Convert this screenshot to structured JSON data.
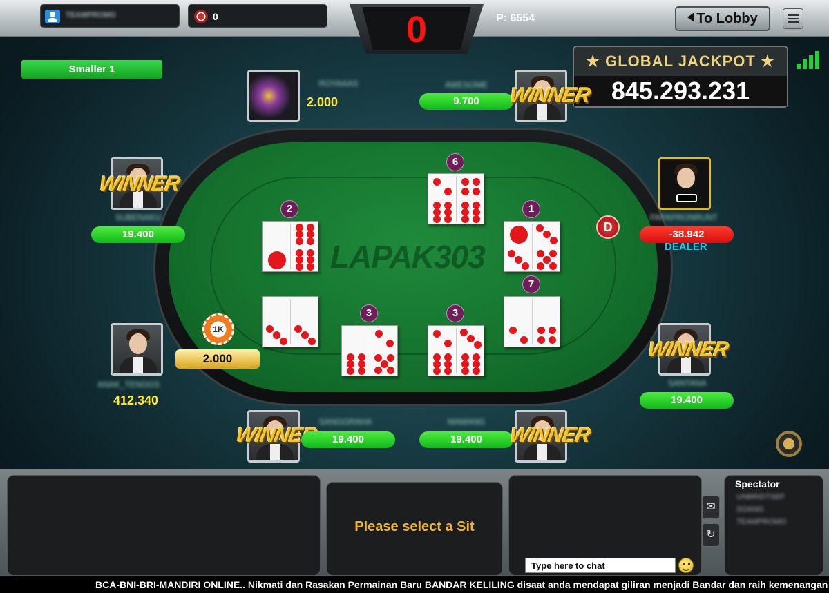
{
  "topbar": {
    "username": "TEAMPROMO",
    "chips": "0",
    "score": "0",
    "points": "P: 6554",
    "lobby_label": "To Lobby"
  },
  "jackpot": {
    "title": "★ GLOBAL JACKPOT ★",
    "value": "845.293.231"
  },
  "rule_banner": "Smaller 1",
  "players": [
    {
      "seat": "top-left",
      "name": "ROYAAAS",
      "amount": "2.000",
      "winner": false
    },
    {
      "seat": "top-right",
      "name": "AWESOME",
      "amount": "9.700",
      "winner": true
    },
    {
      "seat": "left",
      "name": "SUBENAKU",
      "amount": "19.400",
      "winner": true
    },
    {
      "seat": "right-dealer",
      "name": "PAPAPRONRUNT",
      "amount": "-38.942",
      "winner": false,
      "role": "DEALER"
    },
    {
      "seat": "bottom-left-self",
      "name": "ANAK_TENGGS",
      "amount": "412.340",
      "winner": false
    },
    {
      "seat": "right-lower",
      "name": "SANTANA",
      "amount": "19.400",
      "winner": true
    },
    {
      "seat": "bottom-left",
      "name": "SANGGRAHA",
      "amount": "19.400",
      "winner": true
    },
    {
      "seat": "bottom-right",
      "name": "MAMANG",
      "amount": "19.400",
      "winner": true
    }
  ],
  "winner_label": "WINNER",
  "dealer_button": "D",
  "table_logo": "LAPAK303",
  "bet": {
    "chip": "1K",
    "amount": "2.000"
  },
  "dominoes": [
    {
      "id": "top",
      "badge": "6",
      "left": [
        2,
        6
      ],
      "right": [
        4,
        6
      ]
    },
    {
      "id": "left",
      "badge": "2",
      "left": [
        0,
        1
      ],
      "right": [
        6,
        6
      ]
    },
    {
      "id": "right",
      "badge": "1",
      "left": [
        1,
        3
      ],
      "right": [
        3,
        5
      ]
    },
    {
      "id": "right-lower",
      "badge": "7",
      "left": [
        0,
        2
      ],
      "right": [
        0,
        4
      ]
    },
    {
      "id": "self",
      "badge": "",
      "left": [
        0,
        3
      ],
      "right": [
        0,
        3
      ]
    },
    {
      "id": "bottom-left",
      "badge": "3",
      "left": [
        0,
        6
      ],
      "right": [
        2,
        5
      ]
    },
    {
      "id": "bottom-right",
      "badge": "3",
      "left": [
        2,
        6
      ],
      "right": [
        3,
        6
      ]
    }
  ],
  "bottom": {
    "select_sit": "Please select a Sit",
    "chat_placeholder": "Type here to chat",
    "spectator_title": "Spectator",
    "spectators": [
      "UNBRIDTSEF",
      "SOANG",
      "TEAMPROMO"
    ]
  },
  "ticker": "BCA-BNI-BRI-MANDIRI ONLINE.. Nikmati dan Rasakan Permainan Baru BANDAR KELILING disaat anda mendapat giliran menjadi Bandar dan raih kemenangan",
  "colors": {
    "felt": "#14712d",
    "pill_green": "#11b91a",
    "pill_red": "#d80f0f",
    "pip": "#e3161c",
    "gold": "#f3c32a"
  }
}
